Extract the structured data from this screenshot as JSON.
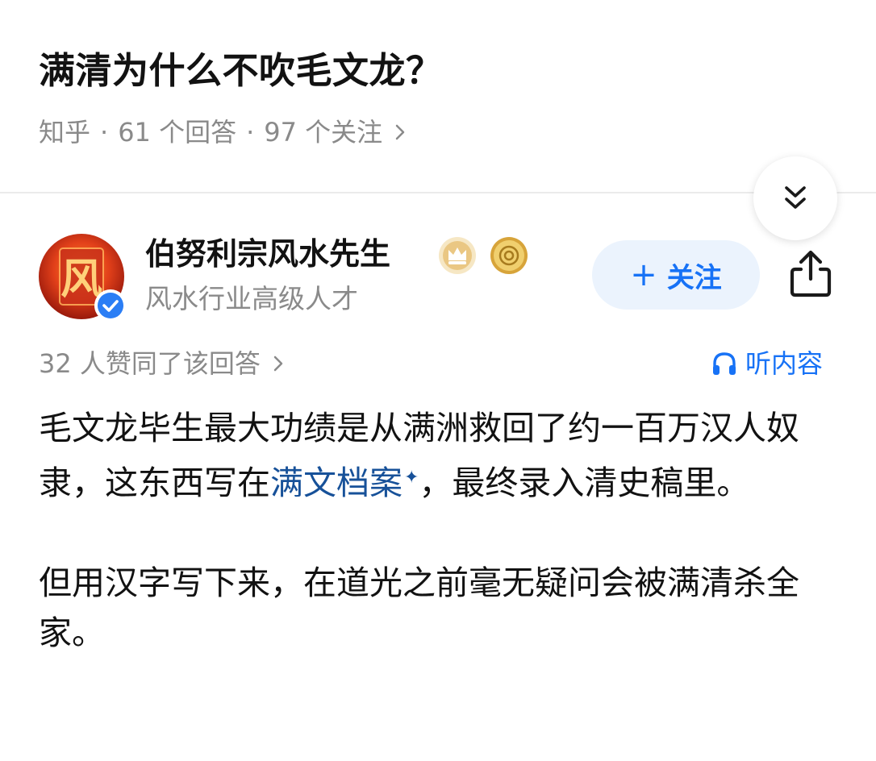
{
  "question": {
    "title": "满清为什么不吹毛文龙？",
    "source": "知乎",
    "separator": "·",
    "answers_count": "61 个回答",
    "followers_count": "97 个关注"
  },
  "author": {
    "name": "伯努利宗风水先生",
    "description": "风水行业高级人才",
    "follow_label": "关注",
    "avatar_char": "风"
  },
  "answer": {
    "votes_text": "32 人赞同了该回答",
    "listen_label": "听内容",
    "p1_before": "毛文龙毕生最大功绩是从满洲救回了约一百万汉人奴隶，这东西写在",
    "p1_keyword": "满文档案",
    "p1_keyword_mark": "✦",
    "p1_after": "，最终录入清史稿里。",
    "p2": "但用汉字写下来，在道光之前毫无疑问会被满清杀全家。"
  },
  "icons": {
    "collapse": "double-chevron-down-icon",
    "share": "share-icon",
    "listen": "headphones-icon",
    "verified": "verified-check-icon",
    "badge_crown": "crown-badge-icon",
    "badge_coin": "coin-badge-icon"
  },
  "colors": {
    "accent": "#1772f6",
    "link": "#175199",
    "muted": "#8a8a8a",
    "text": "#121212",
    "follow_bg": "#ebf3fd"
  }
}
